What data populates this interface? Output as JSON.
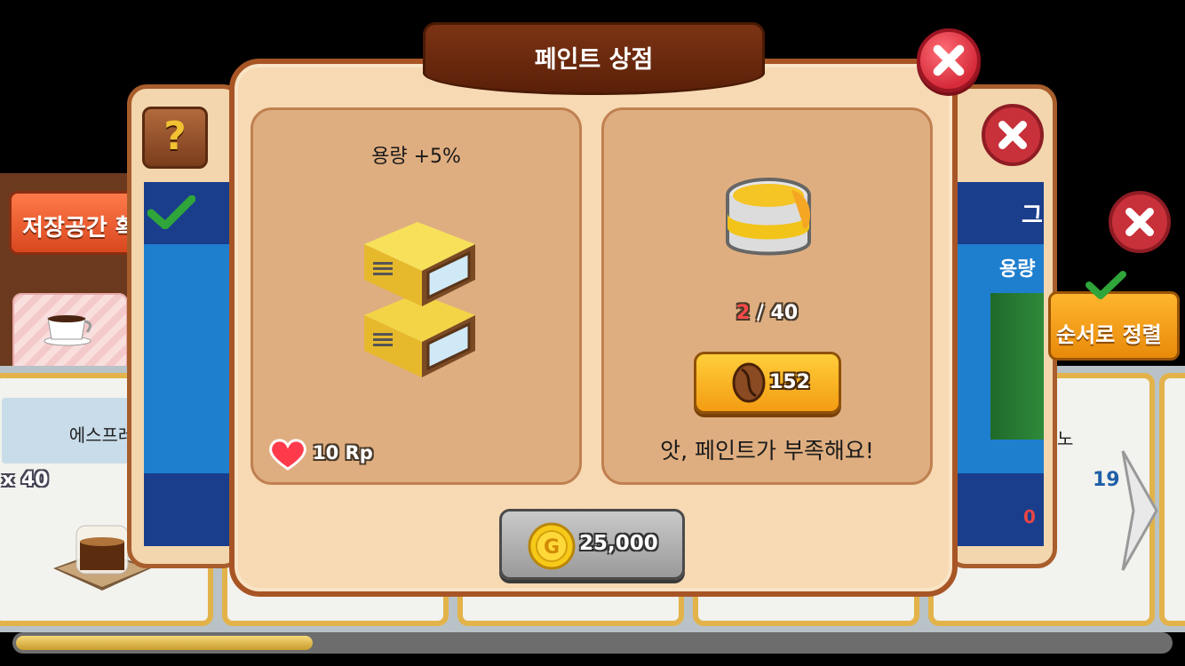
{
  "modal": {
    "title": "페인트 상점",
    "left_panel": {
      "capacity_label": "용량 +5%",
      "reward_label": "10 Rp"
    },
    "right_panel": {
      "paint_current": "2",
      "paint_total": "/ 40",
      "buy_price": "152",
      "warning": "앗, 페인트가 부족해요!"
    },
    "gold_amount": "25,000"
  },
  "background": {
    "storage_button": "저장공간 확",
    "sort_button": "순서로 정렬",
    "shelf_label_left": "에스프레",
    "shelf_label_right": "노",
    "count_left": "x 40",
    "count_right": "19",
    "right_title_partial": "그",
    "right_capacity_partial": "용량",
    "right_paint_count": "0",
    "help_symbol": "?"
  },
  "colors": {
    "modal_bg": "#f7d9b3",
    "panel_bg": "#dfae80",
    "title_banner": "#6b2a0e",
    "close_red": "#d62b3a",
    "buy_orange": "#f39c12",
    "paint_shortage": "#ff4a4a"
  },
  "icons": [
    "close-icon",
    "help-icon",
    "check-icon",
    "heart-icon",
    "paint-can-icon",
    "coffee-bean-icon",
    "gold-coin-icon",
    "shelf-icon",
    "next-arrow-icon"
  ]
}
